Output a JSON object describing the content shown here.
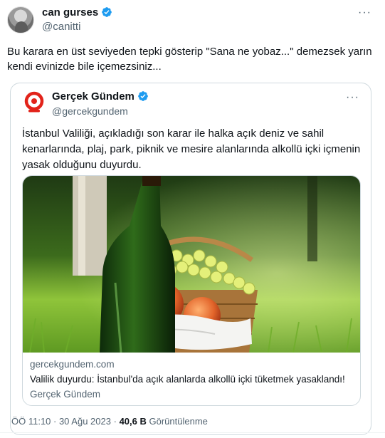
{
  "tweet": {
    "author": {
      "display_name": "can gurses",
      "handle": "@canitti",
      "verified": true
    },
    "more_label": "···",
    "text": "Bu karara en üst seviyeden tepki gösterip \"Sana ne yobaz...\" demezsek yarın kendi evinizde bile içemezsiniz...",
    "timestamp": "ÖÖ 11:10 · 30 Ağu 2023",
    "separator": "·",
    "views_count": "40,6 B",
    "views_label": "Görüntülenme"
  },
  "quoted_tweet": {
    "author": {
      "display_name": "Gerçek Gündem",
      "handle": "@gercekgundem",
      "verified": true
    },
    "more_label": "···",
    "text": "İstanbul Valiliği, açıkladığı son karar ile halka açık deniz ve sahil kenarlarında, plaj, park, piknik ve mesire alanlarında alkollü içki içmenin yasak olduğunu duyurdu.",
    "link_card": {
      "domain": "gercekgundem.com",
      "title": "Valilik duyurdu: İstanbul'da açık alanlarda alkollü içki tüketmek yasaklandı!",
      "source": "Gerçek Gündem"
    }
  },
  "colors": {
    "verified_blue": "#1d9bf0",
    "secondary_text": "#536471",
    "border": "#cfd9de",
    "logo_red": "#e2231a"
  },
  "icons": {
    "verified": "verified-badge-icon",
    "more": "more-horizontal-icon",
    "logo": "gercek-gundem-logo"
  }
}
